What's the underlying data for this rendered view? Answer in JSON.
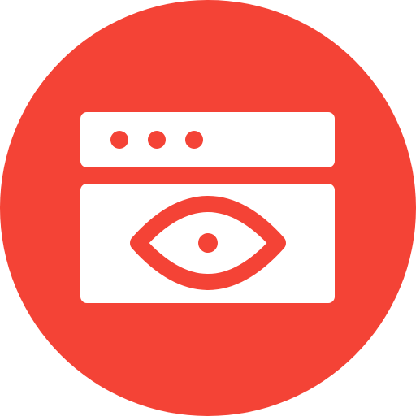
{
  "icon": {
    "name": "browser-eye-icon",
    "colors": {
      "background": "#f44336",
      "foreground": "#ffffff"
    }
  }
}
